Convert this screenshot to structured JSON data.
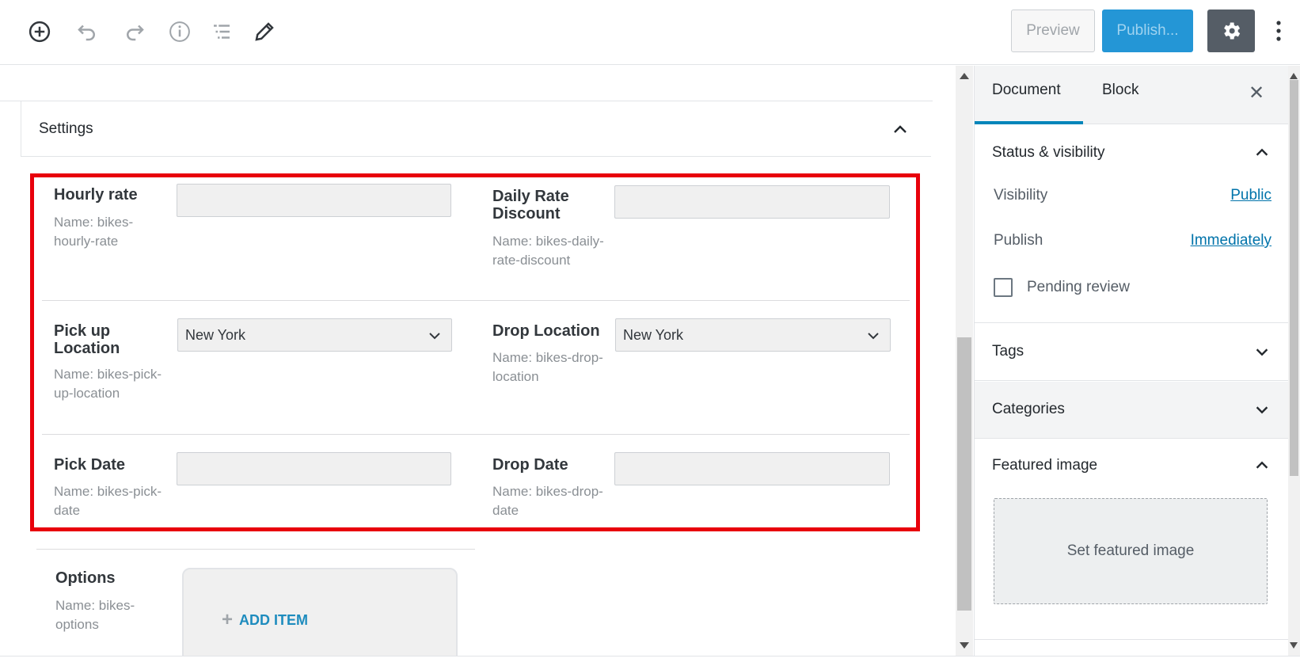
{
  "toolbar": {
    "preview_label": "Preview",
    "publish_label": "Publish..."
  },
  "settings": {
    "title": "Settings"
  },
  "fields": {
    "hourly_rate": {
      "label": "Hourly rate",
      "name_line1": "Name: bikes-",
      "name_line2": "hourly-rate",
      "value": ""
    },
    "daily_rate_discount": {
      "label_line1": "Daily Rate",
      "label_line2": "Discount",
      "name_line1": "Name: bikes-daily-",
      "name_line2": "rate-discount",
      "value": ""
    },
    "pick_up_location": {
      "label_line1": "Pick up",
      "label_line2": "Location",
      "name_line1": "Name: bikes-pick-",
      "name_line2": "up-location",
      "value": "New York"
    },
    "drop_location": {
      "label": "Drop Location",
      "name_line1": "Name: bikes-drop-",
      "name_line2": "location",
      "value": "New York"
    },
    "pick_date": {
      "label": "Pick Date",
      "name_line1": "Name: bikes-pick-",
      "name_line2": "date",
      "value": ""
    },
    "drop_date": {
      "label": "Drop Date",
      "name_line1": "Name: bikes-drop-",
      "name_line2": "date",
      "value": ""
    },
    "options": {
      "label": "Options",
      "name_line1": "Name: bikes-",
      "name_line2": "options",
      "add_item_label": "ADD ITEM"
    }
  },
  "sidebar": {
    "tabs": [
      "Document",
      "Block"
    ],
    "status_visibility": {
      "title": "Status & visibility",
      "visibility_label": "Visibility",
      "visibility_value": "Public",
      "publish_label": "Publish",
      "publish_value": "Immediately",
      "pending_review_label": "Pending review"
    },
    "tags_title": "Tags",
    "categories_title": "Categories",
    "featured_image": {
      "title": "Featured image",
      "button_label": "Set featured image"
    }
  },
  "colors": {
    "highlight_border": "#e8000b",
    "primary": "#2496d6",
    "link": "#0073aa"
  }
}
